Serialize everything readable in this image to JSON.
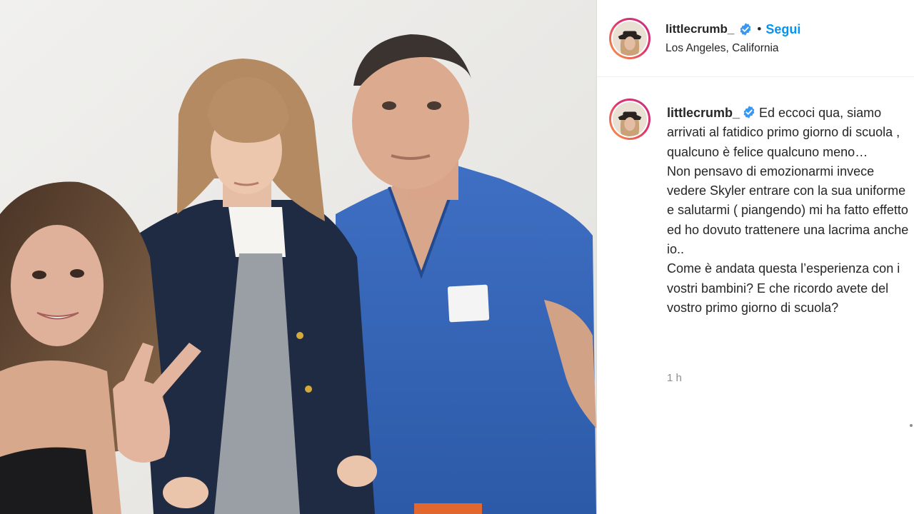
{
  "post": {
    "username": "littlecrumb_",
    "follow_label": "Segui",
    "separator": "•",
    "location": "Los Angeles, California",
    "caption": "Ed eccoci qua, siamo arrivati al fatidico primo giorno di scuola , qualcuno è felice qualcuno meno…\nNon pensavo di emozionarmi invece vedere Skyler entrare con la sua uniforme e salutarmi ( piangendo) mi ha fatto effetto ed ho dovuto trattenere una lacrima anche io..\nCome è andata questa l’esperienza con i vostri bambini? E che ricordo avete del vostro primo giorno di scuola?",
    "timestamp": "1 h"
  },
  "icons": {
    "verified": "verified-badge-icon",
    "avatar": "profile-avatar"
  },
  "colors": {
    "follow": "#0095f6",
    "verified": "#3897f0",
    "ring_start": "#f9a03f",
    "ring_end": "#c13584",
    "muted": "#8e8e8e"
  }
}
